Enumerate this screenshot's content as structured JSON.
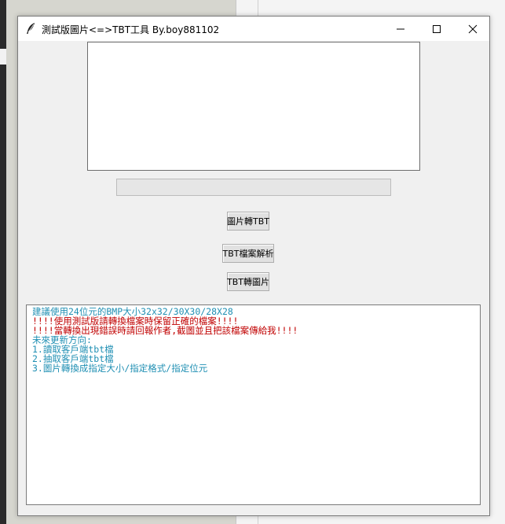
{
  "window": {
    "title": "測試版圖片<=>TBT工具 By.boy881102"
  },
  "progress": {
    "value": 0
  },
  "buttons": {
    "image_to_tbt": "圖片轉TBT",
    "tbt_parse": "TBT檔案解析",
    "tbt_to_image": "TBT轉圖片"
  },
  "log": {
    "lines": [
      {
        "text": "建議使用24位元的BMP大小32x32/30X30/28X28",
        "color": "#1f8fb3"
      },
      {
        "text": "!!!!使用測試版請轉換檔案時保留正確的檔案!!!!",
        "color": "#c00000"
      },
      {
        "text": "!!!!當轉換出現錯誤時請回報作者,截圖並且把該檔案傳給我!!!!",
        "color": "#c00000"
      },
      {
        "text": "未來更新方向:",
        "color": "#1f8fb3"
      },
      {
        "text": "1.讀取客戶端tbt檔",
        "color": "#1f8fb3"
      },
      {
        "text": "2.抽取客戶端tbt檔",
        "color": "#1f8fb3"
      },
      {
        "text": "3.圖片轉換成指定大小/指定格式/指定位元",
        "color": "#1f8fb3"
      }
    ]
  }
}
